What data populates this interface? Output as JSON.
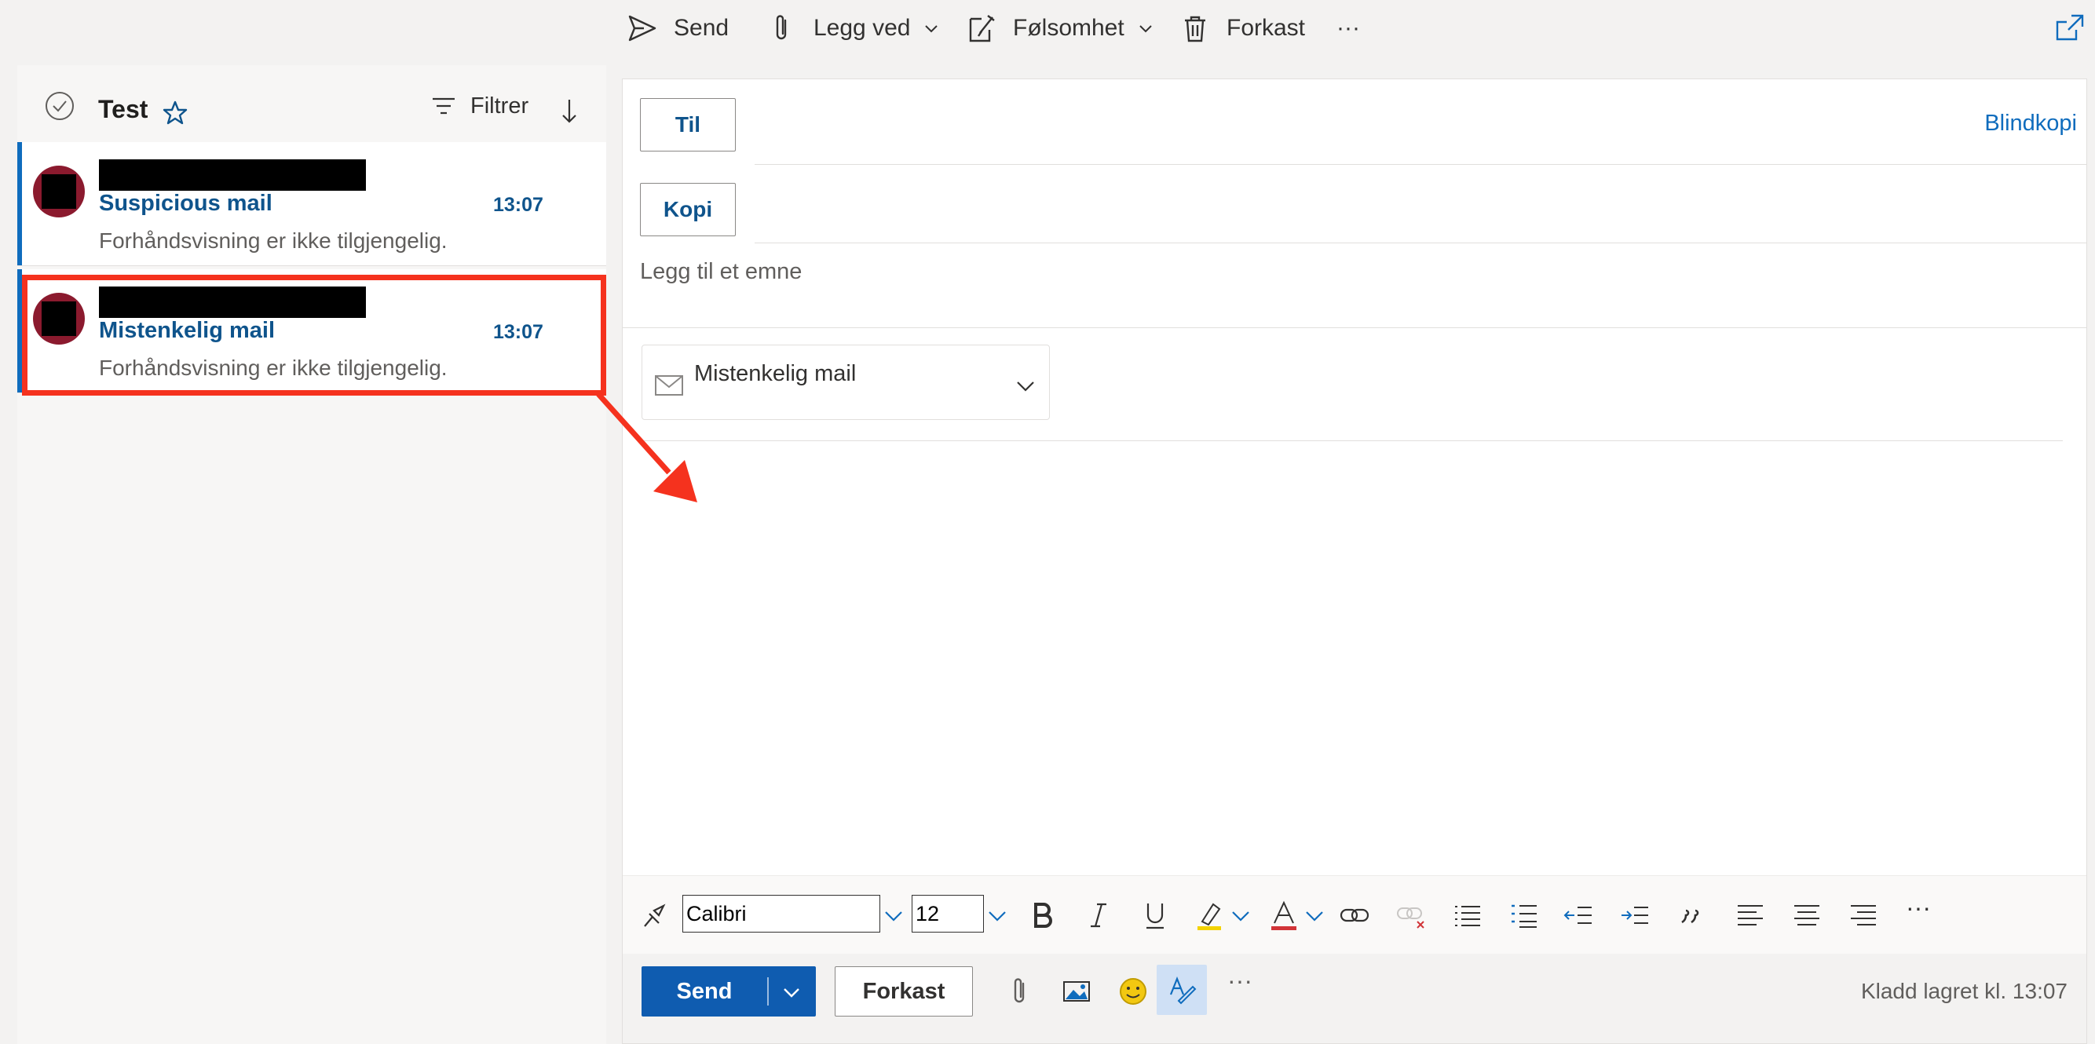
{
  "toolbar": {
    "send": "Send",
    "attach": "Legg ved",
    "sensitivity": "Følsomhet",
    "discard": "Forkast",
    "more": "···"
  },
  "message_list": {
    "folder": "Test",
    "filter": "Filtrer",
    "messages": [
      {
        "subject": "Suspicious mail",
        "time": "13:07",
        "preview": "Forhåndsvisning er ikke tilgjengelig."
      },
      {
        "subject": "Mistenkelig mail",
        "time": "13:07",
        "preview": "Forhåndsvisning er ikke tilgjengelig."
      }
    ]
  },
  "compose": {
    "to_label": "Til",
    "cc_label": "Kopi",
    "bcc_label": "Blindkopi",
    "subject_placeholder": "Legg til et emne",
    "attachment_name": "Mistenkelig mail",
    "font": "Calibri",
    "font_size": "12",
    "more": "···",
    "send_label": "Send",
    "discard_label": "Forkast",
    "draft_status": "Kladd lagret kl. 13:07"
  },
  "colors": {
    "accent": "#0f6cbd",
    "annotation": "#f5321e",
    "avatar": "#8b1a2e"
  },
  "icons": [
    "send-icon",
    "paperclip-icon",
    "sensitivity-icon",
    "trash-icon",
    "popout-icon",
    "check-circle-icon",
    "star-icon",
    "filter-icon",
    "sort-arrow-icon",
    "mail-icon",
    "format-painter-icon",
    "bold-icon",
    "italic-icon",
    "underline-icon",
    "highlight-icon",
    "font-color-icon",
    "link-icon",
    "unlink-icon",
    "bullets-icon",
    "numbering-icon",
    "outdent-icon",
    "indent-icon",
    "quote-icon",
    "align-left-icon",
    "align-center-icon",
    "align-right-icon",
    "image-icon",
    "emoji-icon",
    "editor-icon"
  ]
}
